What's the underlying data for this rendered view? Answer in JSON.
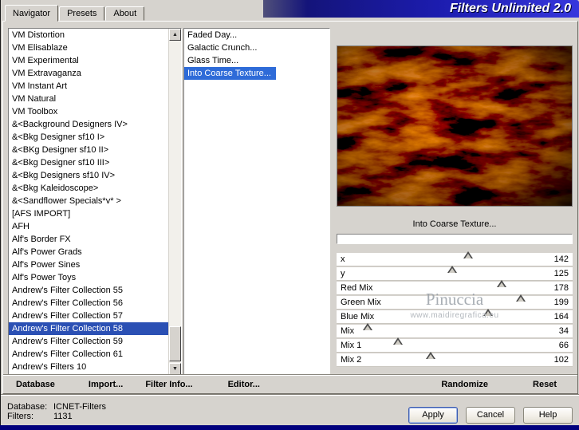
{
  "colors": {
    "selection_left": "#2b50b4",
    "selection_filter": "#2e6bd8",
    "title_start": "#14147a",
    "title_end": "#3636dd"
  },
  "titlebar": {
    "title": "Filters Unlimited 2.0"
  },
  "tabs": {
    "navigator": "Navigator",
    "presets": "Presets",
    "about": "About"
  },
  "icons": {
    "scroll_up": "▲",
    "scroll_down": "▼"
  },
  "category_list": {
    "selected_index": 23,
    "items": [
      "VM Distortion",
      "VM Elisablaze",
      "VM Experimental",
      "VM Extravaganza",
      "VM Instant Art",
      "VM Natural",
      "VM Toolbox",
      "&<Background Designers IV>",
      "&<Bkg Designer sf10 I>",
      "&<BKg Designer sf10 II>",
      "&<Bkg Designer sf10 III>",
      "&<Bkg Designers sf10 IV>",
      "&<Bkg Kaleidoscope>",
      "&<Sandflower Specials*v* >",
      "[AFS IMPORT]",
      "AFH",
      "Alf's Border FX",
      "Alf's Power Grads",
      "Alf's Power Sines",
      "Alf's Power Toys",
      "Andrew's Filter Collection 55",
      "Andrew's Filter Collection 56",
      "Andrew's Filter Collection 57",
      "Andrew's Filter Collection 58",
      "Andrew's Filter Collection 59",
      "Andrew's Filter Collection 61",
      "Andrew's Filters 10"
    ]
  },
  "filter_list": {
    "selected_index": 3,
    "items": [
      "Faded Day...",
      "Galactic Crunch...",
      "Glass Time...",
      "Into Coarse Texture..."
    ]
  },
  "preview": {
    "caption": "Into Coarse Texture..."
  },
  "param_max": 255,
  "params": [
    {
      "label": "x",
      "value": 142
    },
    {
      "label": "y",
      "value": 125
    },
    {
      "label": "Red Mix",
      "value": 178
    },
    {
      "label": "Green Mix",
      "value": 199
    },
    {
      "label": "Blue Mix",
      "value": 164
    },
    {
      "label": "Mix",
      "value": 34
    },
    {
      "label": "Mix 1",
      "value": 66
    },
    {
      "label": "Mix 2",
      "value": 102
    }
  ],
  "watermark": {
    "line1": "Pinuccia",
    "line2": "www.maidiregrafica.eu"
  },
  "commands": {
    "database": "Database",
    "import": "Import...",
    "filter_info": "Filter Info...",
    "editor": "Editor...",
    "randomize": "Randomize",
    "reset": "Reset"
  },
  "status": {
    "database_label": "Database:",
    "database_value": "ICNET-Filters",
    "filters_label": "Filters:",
    "filters_value": "1131"
  },
  "buttons": {
    "apply": "Apply",
    "cancel": "Cancel",
    "help": "Help"
  }
}
